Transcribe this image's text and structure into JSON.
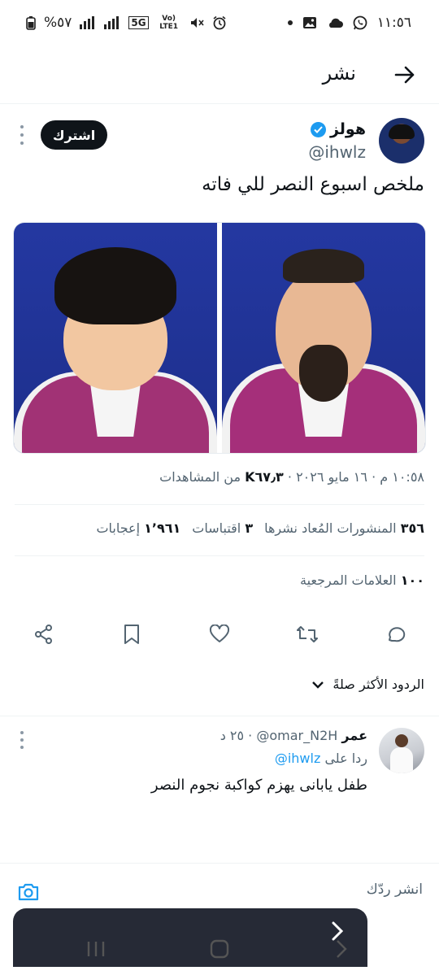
{
  "status_bar": {
    "time": "١١:٥٦",
    "battery": "%٥٧",
    "network": "5G",
    "lte": "Vo) LTE1"
  },
  "header": {
    "title": "نشر"
  },
  "tweet": {
    "author_name": "هولز",
    "author_handle": "@ihwlz",
    "subscribe_label": "اشترك",
    "text": "ملخص اسبوع النصر للي فاته",
    "timestamp": "١٠:٥٨ م · ١٦ مايو ٢٠٢٦ · ",
    "views_count": "K٦٧٫٣",
    "views_label": "من المشاهدات",
    "reposts_count": "٣٥٦",
    "reposts_label": "المنشورات المُعاد نشرها",
    "quotes_count": "٣",
    "quotes_label": "اقتباسات",
    "likes_count": "١٬٩٦١",
    "likes_label": "إعجابات",
    "bookmarks_count": "١٠٠",
    "bookmarks_label": "العلامات المرجعية"
  },
  "sort": {
    "label": "الردود الأكثر صلةً"
  },
  "reply": {
    "author_name": "عمر",
    "author_handle": "@omar_N2H",
    "meta": "· ٢٥ د",
    "replying_to_label": "ردا على",
    "replying_to_handle": "@ihwlz",
    "text": "طفل يابانى يهزم كواكبة نجوم النصر"
  },
  "composer": {
    "placeholder": "انشر ردّك"
  },
  "icons": {
    "back": "arrow-right-icon",
    "verified": "verified-badge-icon",
    "reply": "reply-icon",
    "repost": "repost-icon",
    "like": "heart-icon",
    "bookmark": "bookmark-icon",
    "share": "share-icon",
    "camera": "camera-icon"
  },
  "colors": {
    "accent": "#1d9bf0",
    "text": "#0f1419",
    "muted": "#536471"
  }
}
